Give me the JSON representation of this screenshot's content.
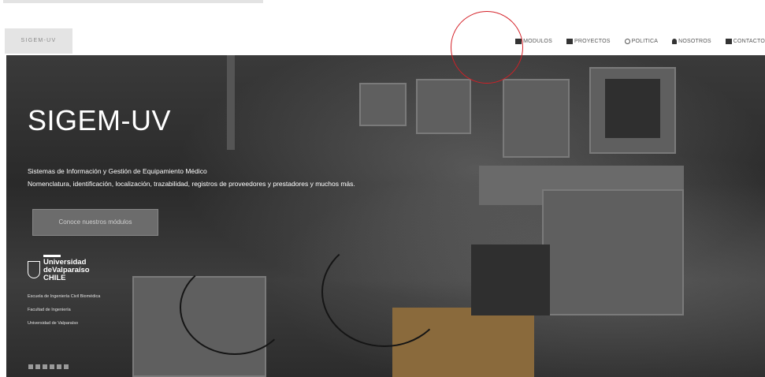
{
  "navbar": {
    "brand": "SIGEM-UV",
    "items": [
      {
        "label": "MODULOS",
        "icon": "grid-icon"
      },
      {
        "label": "PROYECTOS",
        "icon": "table-icon"
      },
      {
        "label": "POLITICA",
        "icon": "power-icon"
      },
      {
        "label": "NOSOTROS",
        "icon": "user-icon"
      },
      {
        "label": "CONTACTO",
        "icon": "mail-icon"
      }
    ],
    "highlight_color": "#d41f26"
  },
  "hero": {
    "title": "SIGEM-UV",
    "subtitle_line1": "Sistemas de Información y Gestión de Equipamiento Médico",
    "subtitle_line2": "Nomenclatura, identificación, localización, trazabilidad, registros de proveedores y prestadores y muchos más.",
    "cta_label": "Conoce nuestros módulos"
  },
  "university": {
    "line1": "Universidad",
    "line2": "deValparaíso",
    "country": "CHILE",
    "school1": "Escuela de Ingeniería Civil Biomédica",
    "school2": "Facultad de Ingeniería",
    "school3": "Universidad de Valparaíso"
  },
  "social_icons": [
    "rss-icon",
    "instagram-icon",
    "circle-icon",
    "pinterest-icon",
    "twitter-icon",
    "linkedin-icon"
  ]
}
